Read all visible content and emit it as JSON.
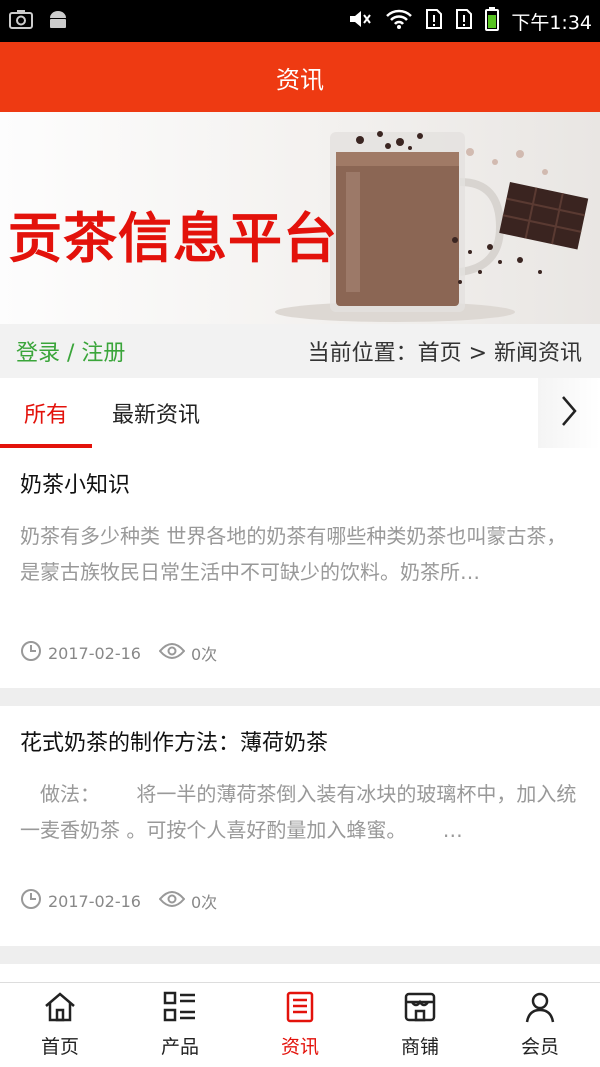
{
  "status_bar": {
    "time": "下午1:34"
  },
  "app_bar": {
    "title": "资讯"
  },
  "banner": {
    "title": "贡茶信息平台"
  },
  "info_bar": {
    "login": "登录 / 注册",
    "breadcrumb": "当前位置：首页 > 新闻资讯"
  },
  "tabs": [
    {
      "label": "所有"
    },
    {
      "label": "最新资讯"
    }
  ],
  "articles": [
    {
      "title": "奶茶小知识",
      "excerpt": "奶茶有多少种类 世界各地的奶茶有哪些种类奶茶也叫蒙古茶，是蒙古族牧民日常生活中不可缺少的饮料。奶茶所…",
      "date": "2017-02-16",
      "views": "0次"
    },
    {
      "title": "花式奶茶的制作方法：薄荷奶茶",
      "excerpt": "　做法：　　 将一半的薄荷茶倒入装有冰块的玻璃杯中，加入统一麦香奶茶 。可按个人喜好酌量加入蜂蜜。　　 …",
      "date": "2017-02-16",
      "views": "0次"
    }
  ],
  "bottom_nav": [
    {
      "label": "首页",
      "icon": "home-icon"
    },
    {
      "label": "产品",
      "icon": "list-icon"
    },
    {
      "label": "资讯",
      "icon": "news-icon"
    },
    {
      "label": "商铺",
      "icon": "store-icon"
    },
    {
      "label": "会员",
      "icon": "user-icon"
    }
  ],
  "colors": {
    "accent": "#ee3a12",
    "active": "#e3120b",
    "login": "#3aa53a"
  }
}
